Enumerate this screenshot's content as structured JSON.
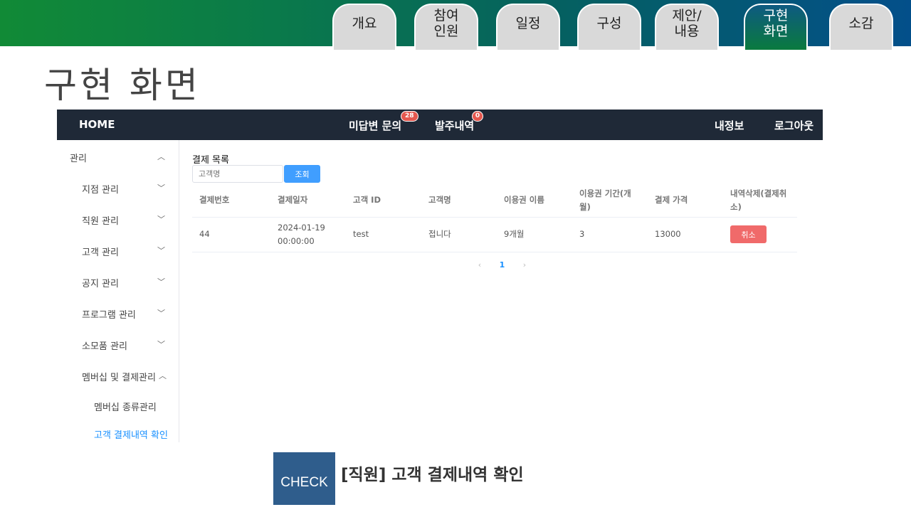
{
  "slide": {
    "tabs": [
      {
        "label": "개요"
      },
      {
        "label": "참여\n인원"
      },
      {
        "label": "일정"
      },
      {
        "label": "구성"
      },
      {
        "label": "제안/\n내용"
      },
      {
        "label": "구현\n화면",
        "active": true
      },
      {
        "label": "소감"
      }
    ],
    "title": "구현 화면",
    "check_label": "CHECK",
    "check_text": "[직원] 고객 결제내역 확인"
  },
  "navbar": {
    "home": "HOME",
    "unanswered": "미답변 문의",
    "unanswered_count": "28",
    "orders": "발주내역",
    "orders_count": "0",
    "my_info": "내정보",
    "logout": "로그아웃"
  },
  "sidebar": {
    "items": [
      {
        "label": "관리",
        "chevron": "up"
      },
      {
        "label": "지점 관리",
        "chevron": "down"
      },
      {
        "label": "직원 관리",
        "chevron": "down"
      },
      {
        "label": "고객 관리",
        "chevron": "down"
      },
      {
        "label": "공지 관리",
        "chevron": "down"
      },
      {
        "label": "프로그램 관리",
        "chevron": "down"
      },
      {
        "label": "소모품 관리",
        "chevron": "down"
      },
      {
        "label": "멤버십 및 결제관리",
        "chevron": "up"
      },
      {
        "label": "멤버십 종류관리"
      },
      {
        "label": "고객 결제내역 확인",
        "active": true
      }
    ]
  },
  "content": {
    "title": "결제 목록",
    "search_placeholder": "고객명",
    "search_button": "조회",
    "columns": [
      "결제번호",
      "결제일자",
      "고객 ID",
      "고객명",
      "이용권 이름",
      "이용권 기간(개월)",
      "결제 가격",
      "내역삭제(결제취소)"
    ],
    "rows": [
      {
        "id": "44",
        "date": "2024-01-19 00:00:00",
        "customer_id": "test",
        "customer_name": "접니다",
        "pass_name": "9개월",
        "period": "3",
        "price": "13000",
        "action": "취소"
      }
    ],
    "pagination": {
      "prev": "‹",
      "current": "1",
      "next": "›"
    }
  },
  "colors": {
    "primary": "#409eff",
    "danger": "#f06a6a",
    "navbar": "#1f2937",
    "check": "#2f5d8c"
  }
}
